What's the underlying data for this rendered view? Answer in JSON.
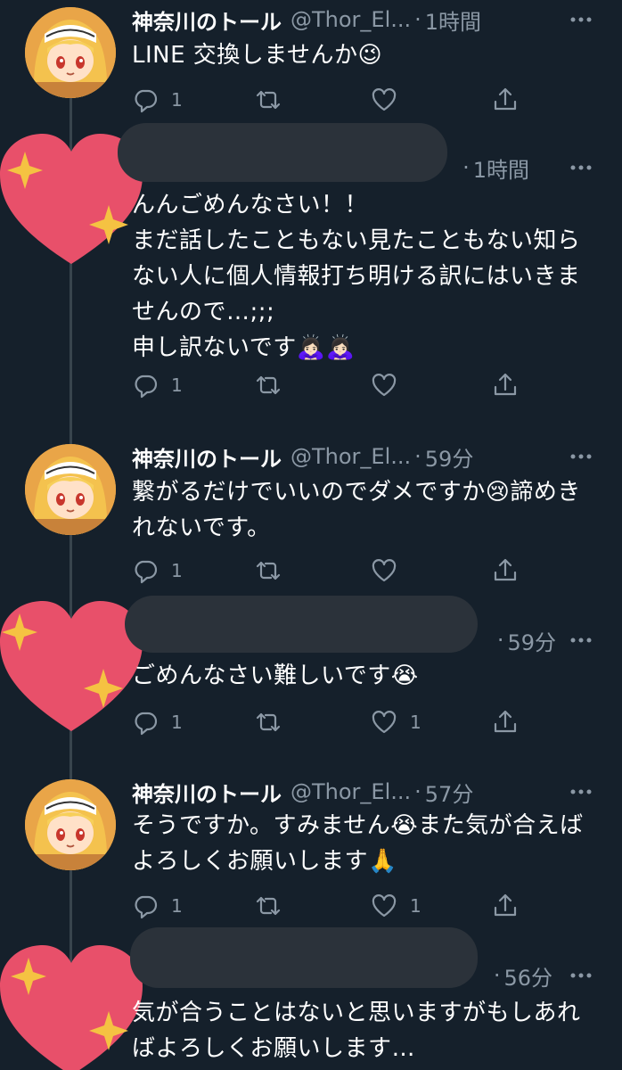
{
  "colors": {
    "background": "#15202b",
    "text": "#ffffff",
    "muted": "#8b98a5",
    "thread_line": "#38444d",
    "redaction": "#2b323a",
    "heart": "#e8506a",
    "sparkle": "#f5c242"
  },
  "tweets": [
    {
      "display_name": "神奈川のトール",
      "handle": "@Thor_El...",
      "separator": "·",
      "time": "1時間",
      "text": "LINE 交換しませんか😉",
      "reply_count": "1",
      "like_count": "",
      "avatar": "anime-girl-avatar"
    },
    {
      "display_name": "",
      "handle": "",
      "separator": "·",
      "time": "1時間",
      "text": "んんごめんなさい！！\nまだ話したこともない見たこともない知らない人に個人情報打ち明ける訳にはいきませんので…;;;\n申し訳ないです🙇🏻‍♀️🙇🏻‍♀️",
      "reply_count": "1",
      "like_count": "",
      "avatar": "heart-sticker"
    },
    {
      "display_name": "神奈川のトール",
      "handle": "@Thor_El...",
      "separator": "·",
      "time": "59分",
      "text": "繋がるだけでいいのでダメですか😢諦めきれないです。",
      "reply_count": "1",
      "like_count": "",
      "avatar": "anime-girl-avatar"
    },
    {
      "display_name": "",
      "handle": "",
      "separator": "·",
      "time": "59分",
      "text": "ごめんなさい難しいです😭",
      "reply_count": "1",
      "like_count": "1",
      "avatar": "heart-sticker"
    },
    {
      "display_name": "神奈川のトール",
      "handle": "@Thor_El...",
      "separator": "·",
      "time": "57分",
      "text": "そうですか。すみません😭また気が合えばよろしくお願いします🙏",
      "reply_count": "1",
      "like_count": "1",
      "avatar": "anime-girl-avatar"
    },
    {
      "display_name": "",
      "handle": "",
      "separator": "·",
      "time": "56分",
      "text": "気が合うことはないと思いますがもしあればよろしくお願いします…",
      "reply_count": "",
      "like_count": "",
      "avatar": "heart-sticker"
    }
  ]
}
